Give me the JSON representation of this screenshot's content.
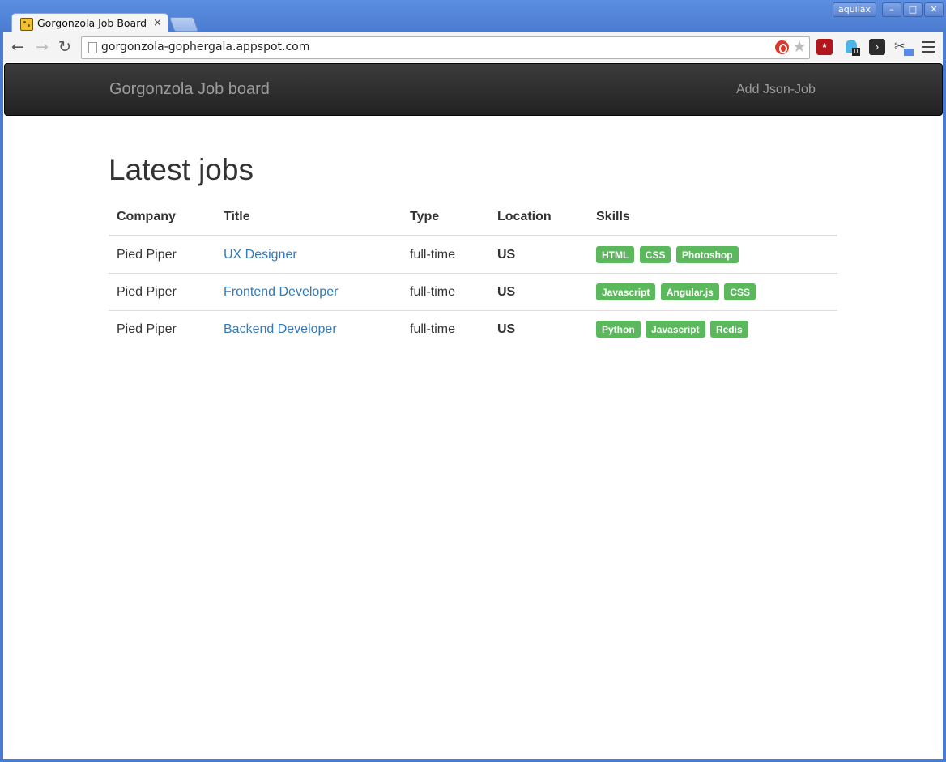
{
  "browser": {
    "user": "aquilax",
    "tab_title": "Gorgonzola Job Board",
    "tab_close": "×",
    "url": "gorgonzola-gophergala.appspot.com",
    "window_buttons": {
      "minimize": "–",
      "maximize": "□",
      "close": "✕"
    },
    "nav": {
      "back": "←",
      "forward": "→",
      "reload": "↻"
    },
    "star": "★",
    "ghostery_count": "0",
    "extensions": [
      "lastpass-icon",
      "ghostery-icon",
      "dark-reader-icon",
      "screenshot-icon"
    ]
  },
  "navbar": {
    "brand": "Gorgonzola Job board",
    "link": "Add Json-Job"
  },
  "main": {
    "heading": "Latest jobs",
    "columns": [
      "Company",
      "Title",
      "Type",
      "Location",
      "Skills"
    ],
    "rows": [
      {
        "company": "Pied Piper",
        "title": "UX Designer",
        "type": "full-time",
        "location": "US",
        "skills": [
          "HTML",
          "CSS",
          "Photoshop"
        ]
      },
      {
        "company": "Pied Piper",
        "title": "Frontend Developer",
        "type": "full-time",
        "location": "US",
        "skills": [
          "Javascript",
          "Angular.js",
          "CSS"
        ]
      },
      {
        "company": "Pied Piper",
        "title": "Backend Developer",
        "type": "full-time",
        "location": "US",
        "skills": [
          "Python",
          "Javascript",
          "Redis"
        ]
      }
    ]
  },
  "colors": {
    "navbar_bg": "#222222",
    "link": "#337ab7",
    "skill_label": "#5cb85c"
  }
}
